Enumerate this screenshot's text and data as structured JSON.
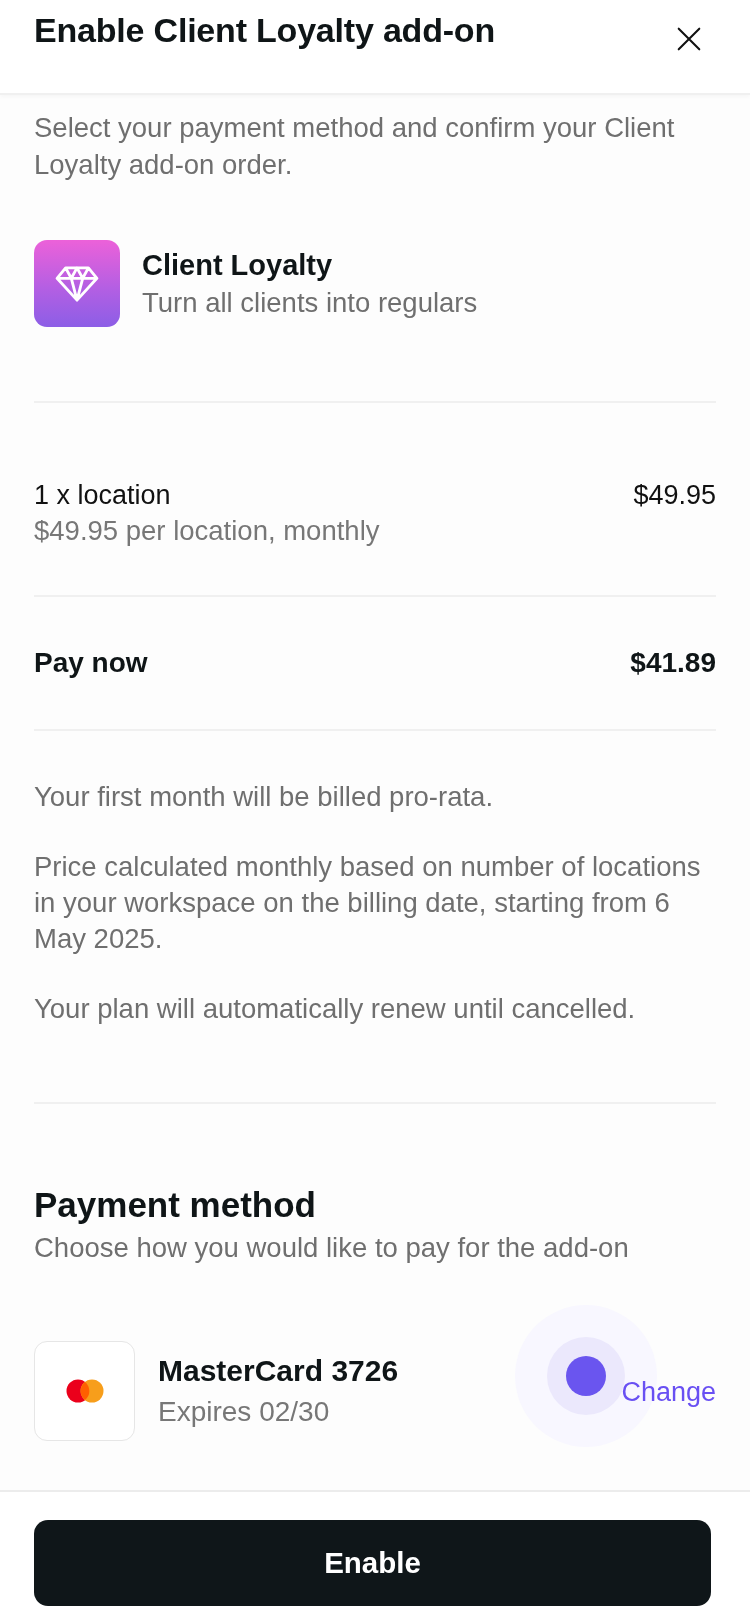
{
  "header": {
    "title": "Enable Client Loyalty add-on"
  },
  "intro": "Select your payment method and confirm your Client Loyalty add-on order.",
  "product": {
    "name": "Client Loyalty",
    "tagline": "Turn all clients into regulars"
  },
  "line_items": [
    {
      "label": "1 x location",
      "detail": "$49.95 per location, monthly",
      "amount": "$49.95"
    }
  ],
  "total": {
    "label": "Pay now",
    "amount": "$41.89"
  },
  "notes": [
    "Your first month will be billed pro-rata.",
    "Price calculated monthly based on number of locations in your workspace on the billing date, starting from 6 May 2025.",
    "Your plan will automatically renew until cancelled."
  ],
  "payment_method": {
    "title": "Payment method",
    "subtitle": "Choose how you would like to pay for the add-on",
    "card": {
      "name": "MasterCard 3726",
      "expiry": "Expires 02/30"
    },
    "change_label": "Change"
  },
  "footer": {
    "button": "Enable"
  }
}
